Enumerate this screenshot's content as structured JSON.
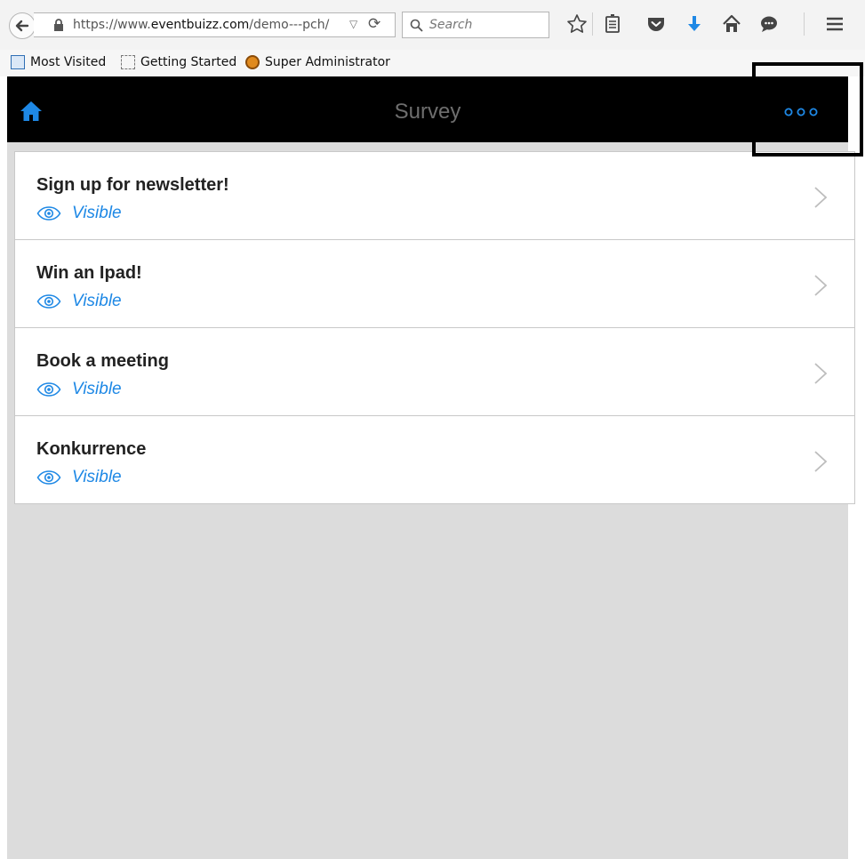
{
  "browser": {
    "url_prefix": "https://www.",
    "url_domain": "eventbuizz.com",
    "url_path": "/demo---pch/",
    "search_placeholder": "Search",
    "bookmarks": [
      {
        "label": "Most Visited",
        "icon": "most-visited-icon"
      },
      {
        "label": "Getting Started",
        "icon": "getting-started-icon"
      },
      {
        "label": "Super Administrator",
        "icon": "admin-icon"
      }
    ],
    "accent_color": "#1e88e5"
  },
  "app": {
    "title": "Survey",
    "header_bg": "#000000",
    "accent_color": "#1e88e5",
    "surveys": [
      {
        "title": "Sign up for newsletter!",
        "status": "Visible"
      },
      {
        "title": "Win an Ipad!",
        "status": "Visible"
      },
      {
        "title": "Book a meeting",
        "status": "Visible"
      },
      {
        "title": "Konkurrence",
        "status": "Visible"
      }
    ]
  }
}
